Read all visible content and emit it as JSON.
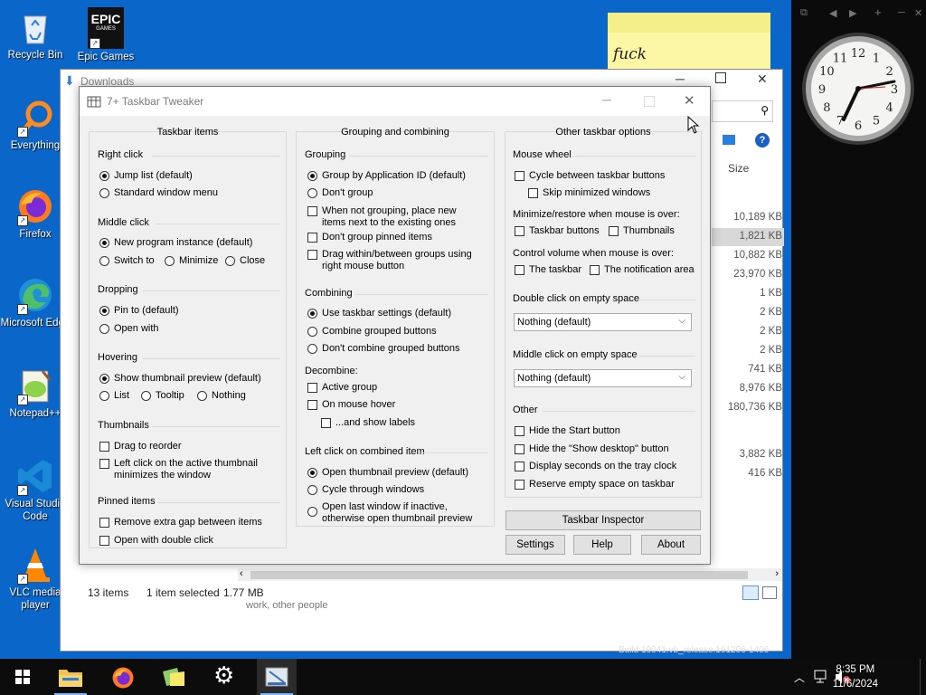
{
  "desktop": {
    "icons": [
      {
        "label": "Recycle Bin"
      },
      {
        "label": "Epic Games"
      },
      {
        "label": "Everything"
      },
      {
        "label": "Firefox"
      },
      {
        "label": "Microsoft Edge"
      },
      {
        "label": "Notepad++"
      },
      {
        "label": "Visual Studio Code"
      },
      {
        "label": "VLC media player"
      }
    ],
    "epic_logo_top": "EPIC",
    "epic_logo_bottom": "GAMES",
    "sticky_text": "fuck",
    "build_text": "Build 19041.vb_release.191206-1406"
  },
  "gadget": {
    "clock_numbers": [
      "12",
      "1",
      "2",
      "3",
      "4",
      "5",
      "6",
      "7",
      "8",
      "9",
      "10",
      "11"
    ]
  },
  "explorer": {
    "title": "Downloads",
    "size_header": "Size",
    "sizes": [
      "10,189 KB",
      "1,821 KB",
      "10,882 KB",
      "23,970 KB",
      "1 KB",
      "2 KB",
      "2 KB",
      "2 KB",
      "741 KB",
      "8,976 KB",
      "180,736 KB",
      "",
      "3,882 KB",
      "416 KB"
    ],
    "status_items": "13 items",
    "status_selected": "1 item selected",
    "status_size": "1.77 MB",
    "behind_text": "work, other people"
  },
  "dialog": {
    "title": "7+ Taskbar Tweaker",
    "col1": {
      "header": "Taskbar items",
      "right_click": "Right click",
      "jump_list": "Jump list (default)",
      "standard_menu": "Standard window menu",
      "middle_click": "Middle click",
      "new_instance": "New program instance (default)",
      "switch_to": "Switch to",
      "minimize": "Minimize",
      "close": "Close",
      "dropping": "Dropping",
      "pin_to": "Pin to (default)",
      "open_with": "Open with",
      "hovering": "Hovering",
      "show_thumb": "Show thumbnail preview (default)",
      "list": "List",
      "tooltip": "Tooltip",
      "nothing": "Nothing",
      "thumbnails": "Thumbnails",
      "drag_reorder": "Drag to reorder",
      "left_click_thumb": "Left click on the active thumbnail minimizes the window",
      "pinned_items": "Pinned items",
      "remove_gap": "Remove extra gap between items",
      "open_double": "Open with double click"
    },
    "col2": {
      "header": "Grouping and combining",
      "grouping": "Grouping",
      "group_app_id": "Group by Application ID (default)",
      "dont_group": "Don't group",
      "when_not_grouping": "When not grouping, place new items next to the existing ones",
      "dont_group_pinned": "Don't group pinned items",
      "drag_within": "Drag within/between groups using right mouse button",
      "combining": "Combining",
      "use_taskbar_settings": "Use taskbar settings (default)",
      "combine_grouped": "Combine grouped buttons",
      "dont_combine": "Don't combine grouped buttons",
      "decombine": "Decombine:",
      "active_group": "Active group",
      "on_mouse_hover": "On mouse hover",
      "and_show_labels": "...and show labels",
      "left_click_combined": "Left click on combined item",
      "open_thumb_preview": "Open thumbnail preview (default)",
      "cycle_windows": "Cycle through windows",
      "open_last": "Open last window if inactive, otherwise open thumbnail preview"
    },
    "col3": {
      "header": "Other taskbar options",
      "mouse_wheel": "Mouse wheel",
      "cycle_buttons": "Cycle between taskbar buttons",
      "skip_minimized": "Skip minimized windows",
      "min_restore": "Minimize/restore when mouse is over:",
      "taskbar_buttons": "Taskbar buttons",
      "thumbnails": "Thumbnails",
      "control_volume": "Control volume when mouse is over:",
      "the_taskbar": "The taskbar",
      "notification_area": "The notification area",
      "double_click_empty": "Double click on empty space",
      "double_click_value": "Nothing (default)",
      "middle_click_empty": "Middle click on empty space",
      "middle_click_value": "Nothing (default)",
      "other": "Other",
      "hide_start": "Hide the Start button",
      "hide_show_desktop": "Hide the \"Show desktop\" button",
      "display_seconds": "Display seconds on the tray clock",
      "reserve_space": "Reserve empty space on taskbar"
    },
    "buttons": {
      "inspector": "Taskbar Inspector",
      "settings": "Settings",
      "help": "Help",
      "about": "About"
    }
  },
  "taskbar": {
    "time": "8:35 PM",
    "date": "11/6/2024"
  }
}
